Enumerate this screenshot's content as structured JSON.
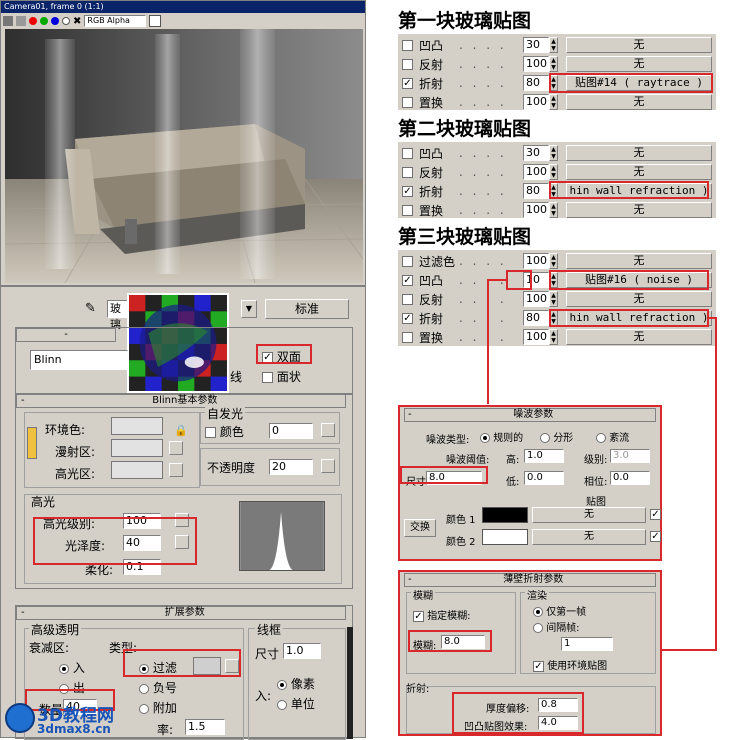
{
  "viewport": {
    "title": "Camera01, frame 0 (1:1)",
    "channel": "RGB Alpha"
  },
  "editor": {
    "material_name": "玻璃",
    "type_button": "标准",
    "shader": "Blinn",
    "two_sided": "双面",
    "faceted": "面状",
    "wire": "线",
    "basic_params_title": "Blinn基本参数",
    "self_illum": "自发光",
    "color_label": "颜色",
    "self_illum_value": "0",
    "ambient": "环境色:",
    "diffuse": "漫射区:",
    "specular": "高光区:",
    "opacity_label": "不透明度",
    "opacity_value": "20",
    "highlights": "高光",
    "spec_level_label": "高光级别:",
    "spec_level_value": "100",
    "gloss_label": "光泽度:",
    "gloss_value": "40",
    "soften_label": "柔化:",
    "soften_value": "0.1",
    "extended_title": "扩展参数",
    "adv_trans": "高级透明",
    "falloff": "衰减区:",
    "type_label": "类型:",
    "in": "入",
    "out": "出",
    "filter": "过滤",
    "subtractive": "负号",
    "additive": "附加",
    "amount_label": "数量",
    "amount_value": "40",
    "index_label": "率:",
    "index_value": "1.5",
    "wire_group": "线框",
    "size_label": "尺寸",
    "size_value": "1.0",
    "in_label": "入:",
    "pixels": "像素",
    "units": "单位",
    "watermark": "3D教程网",
    "watermark_url": "3dmax8.cn"
  },
  "maps": {
    "title1": "第一块玻璃贴图",
    "title2": "第二块玻璃贴图",
    "title3": "第三块玻璃贴图",
    "rows1": [
      {
        "name": "凹凸",
        "checked": false,
        "amount": "30",
        "map": "无"
      },
      {
        "name": "反射",
        "checked": false,
        "amount": "100",
        "map": "无"
      },
      {
        "name": "折射",
        "checked": true,
        "amount": "80",
        "map": "贴图#14  ( raytrace )"
      },
      {
        "name": "置换",
        "checked": false,
        "amount": "100",
        "map": "无"
      }
    ],
    "rows2": [
      {
        "name": "凹凸",
        "checked": false,
        "amount": "30",
        "map": "无"
      },
      {
        "name": "反射",
        "checked": false,
        "amount": "100",
        "map": "无"
      },
      {
        "name": "折射",
        "checked": true,
        "amount": "80",
        "map": "hin wall refraction )"
      },
      {
        "name": "置换",
        "checked": false,
        "amount": "100",
        "map": "无"
      }
    ],
    "rows3": [
      {
        "name": "过滤色",
        "checked": false,
        "amount": "100",
        "map": "无"
      },
      {
        "name": "凹凸",
        "checked": true,
        "amount": "10",
        "map": "贴图#16  ( noise )"
      },
      {
        "name": "反射",
        "checked": false,
        "amount": "100",
        "map": "无"
      },
      {
        "name": "折射",
        "checked": true,
        "amount": "80",
        "map": "hin wall refraction )"
      },
      {
        "name": "置换",
        "checked": false,
        "amount": "100",
        "map": "无"
      }
    ]
  },
  "noise": {
    "title": "噪波参数",
    "type_label": "噪波类型:",
    "regular": "规则的",
    "fractal": "分形",
    "turbulence": "紊流",
    "threshold": "噪波阈值:",
    "high": "高:",
    "high_value": "1.0",
    "levels": "级别:",
    "levels_value": "3.0",
    "low": "低:",
    "low_value": "0.0",
    "phase": "相位:",
    "phase_value": "0.0",
    "size_label": "尺寸",
    "size_value": "8.0",
    "maps": "贴图",
    "swap": "交换",
    "color1": "颜色 1",
    "color2": "颜色 2",
    "none": "无"
  },
  "thinwall": {
    "title": "薄壁折射参数",
    "blur_group": "模糊",
    "apply_blur": "指定模糊:",
    "blur_label": "模糊:",
    "blur_value": "8.0",
    "render_group": "渲染",
    "first_frame": "仅第一帧",
    "every_nth": "间隔帧:",
    "nth_value": "1",
    "use_env": "使用环境贴图",
    "refraction": "折射:",
    "thickness_label": "厚度偏移:",
    "thickness_value": "0.8",
    "bump_label": "凹凸贴图效果:",
    "bump_value": "4.0"
  }
}
